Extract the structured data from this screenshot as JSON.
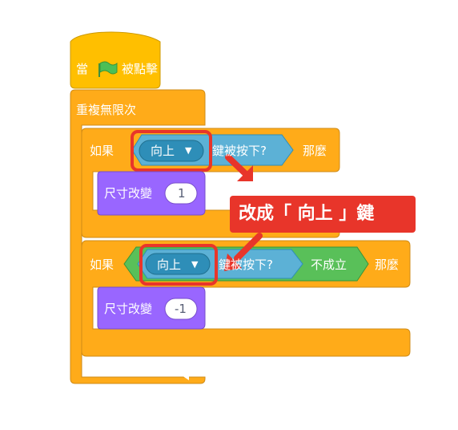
{
  "hat_block": {
    "prefix": "當",
    "flag_icon": "green-flag-icon",
    "suffix": "被點擊"
  },
  "forever_block": {
    "label": "重複無限次",
    "loop_icon": "loop-arrow-icon"
  },
  "if_block_1": {
    "if_label": "如果",
    "key_dropdown_value": "向上",
    "key_pressed_suffix": "鍵被按下?",
    "then_label": "那麼"
  },
  "change_size_1": {
    "label": "尺寸改變",
    "value": "1"
  },
  "if_block_2": {
    "if_label": "如果",
    "key_dropdown_value": "向上",
    "key_pressed_suffix": "鍵被按下?",
    "not_label": "不成立",
    "then_label": "那麼"
  },
  "change_size_2": {
    "label": "尺寸改變",
    "value": "-1"
  },
  "annotation": {
    "text": "改成「 向上 」鍵",
    "arrow_icon": "red-arrow-icon"
  },
  "colors": {
    "events": "#ffbf00",
    "control": "#ffab19",
    "sensing": "#5cb1d6",
    "operators": "#59c059",
    "looks": "#9966ff",
    "highlight": "#e8352a"
  }
}
